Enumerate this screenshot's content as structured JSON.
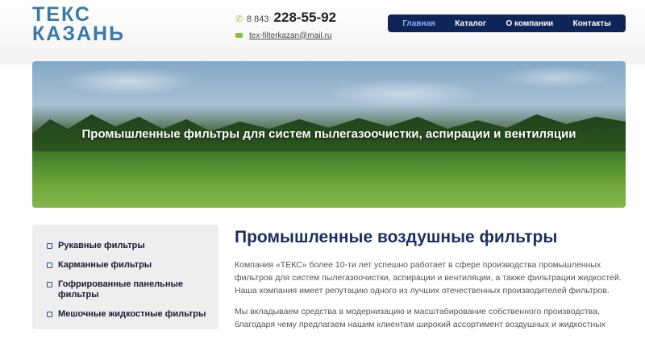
{
  "header": {
    "logo_line1": "ТЕКС",
    "logo_line2": "КАЗАНЬ",
    "phone_prefix": "8 843",
    "phone_number": "228-55-92",
    "email": "tex-filterkazan@mail.ru",
    "phone_icon": "phone-icon",
    "mail_icon": "mail-icon"
  },
  "nav": {
    "items": [
      {
        "label": "Главная",
        "active": true
      },
      {
        "label": "Каталог",
        "active": false
      },
      {
        "label": "О компании",
        "active": false
      },
      {
        "label": "Контакты",
        "active": false
      }
    ]
  },
  "banner": {
    "title": "Промышленные фильтры для систем пылегазоочистки, аспирации и вентиляции"
  },
  "sidebar": {
    "items": [
      {
        "label": "Рукавные фильтры"
      },
      {
        "label": "Карманные фильтры"
      },
      {
        "label": "Гофрированные панельные фильтры"
      },
      {
        "label": "Мешочные жидкостные фильтры"
      }
    ]
  },
  "main": {
    "heading": "Промышленные воздушные фильтры",
    "para1": "Компания «ТЕКС» более 10-ти лет успешно работает в сфере производства промышленных фильтров для систем пылегазоочистки, аспирации и вентиляции, а также фильтрации жидкостей. Наша компания имеет репутацию одного из лучших отечественных производителей фильтров.",
    "para2": "Мы вкладываем средства в модернизацию и масштабирование собственного производства, благодаря чему предлагаем нашим клиентам широкий ассортимент воздушных и жидкостных"
  },
  "colors": {
    "nav_bg": "#0f2457",
    "logo": "#3b79a9",
    "accent_green": "#8fbf3f",
    "heading": "#1c2f5f"
  }
}
